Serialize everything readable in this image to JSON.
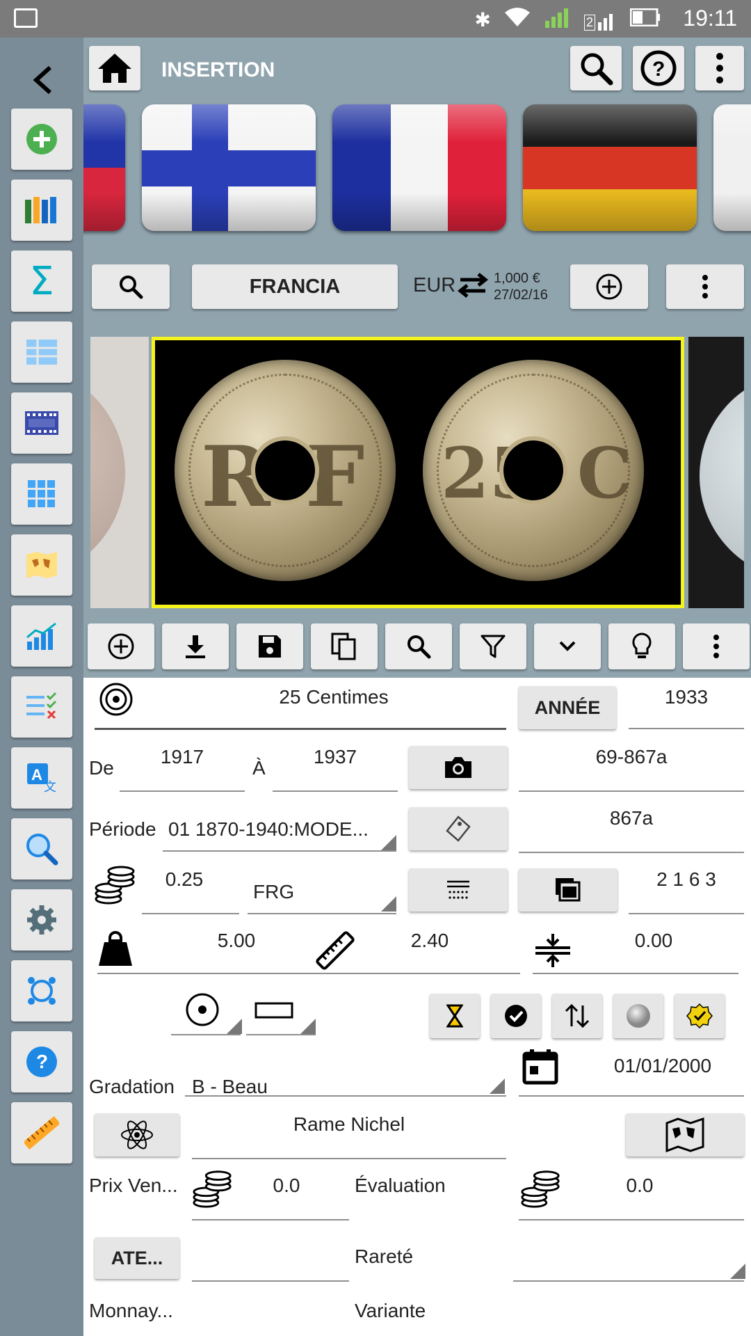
{
  "status_bar": {
    "time": "19:11",
    "sim_badge": "2"
  },
  "header": {
    "title": "INSERTION"
  },
  "country": {
    "name": "FRANCIA",
    "currency": "EUR",
    "rate": "1,000 €",
    "rate_date": "27/02/16"
  },
  "flags": [
    "Finland",
    "France",
    "Germany"
  ],
  "form": {
    "name": "25 Centimes",
    "year_button": "ANNÉE",
    "year": "1933",
    "from_label": "De",
    "from_year": "1917",
    "to_label": "À",
    "to_year": "1937",
    "catalog_code_1": "69-867a",
    "period_label": "Période",
    "period_value": "01 1870-1940:MODE...",
    "catalog_code_2": "867a",
    "face_value": "0.25",
    "currency_unit": "FRG",
    "quantity": "2 1 6 3",
    "weight": "5.00",
    "size": "2.40",
    "thickness": "0.00",
    "grade_label": "Gradation",
    "grade_value": "B - Beau",
    "date": "01/01/2000",
    "metal": "Rame Nichel",
    "sale_price_label": "Prix Ven...",
    "sale_price": "0.0",
    "evaluation_label": "Évaluation",
    "evaluation": "0.0",
    "ate_button": "ATE...",
    "rarity_label": "Rareté",
    "mint_label": "Monnay...",
    "variant_label": "Variante"
  },
  "colors": {
    "sidebar": "#7b8c99",
    "header": "#90a4ae",
    "selection_border": "#f4f41c",
    "status_bar": "#7b7b7b"
  }
}
